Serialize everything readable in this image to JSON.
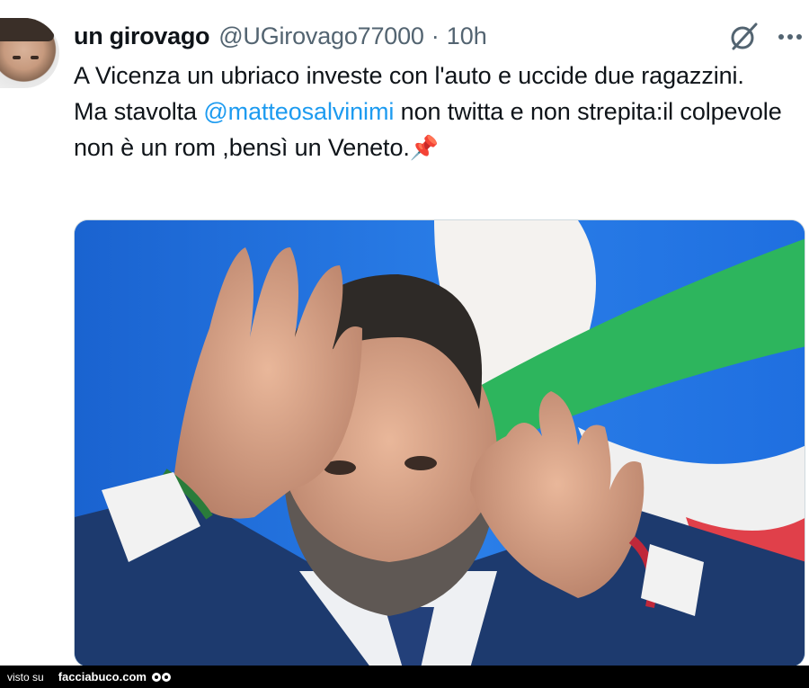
{
  "tweet": {
    "author_name": "un girovago",
    "author_handle": "@UGirovago77000",
    "separator": "·",
    "timestamp": "10h",
    "text_line1": "A Vicenza un ubriaco investe con l'auto e uccide due ragazzini.",
    "text_line2_pre": "Ma stavolta ",
    "mention": "@matteosalvinimi",
    "text_line2_post": " non twitta e non strepita:il colpevole non è un rom ,bensì un Veneto.",
    "pin_emoji": "📌",
    "icons": {
      "grok": "grok-slash-icon",
      "more": "more-horizontal-icon"
    },
    "media_alt": "photo"
  },
  "footer": {
    "visto_su": "visto su",
    "site": "facciabuco.com"
  },
  "colors": {
    "text": "#0f1419",
    "secondary": "#536471",
    "link": "#1d9bf0",
    "border": "#cfd9de"
  }
}
